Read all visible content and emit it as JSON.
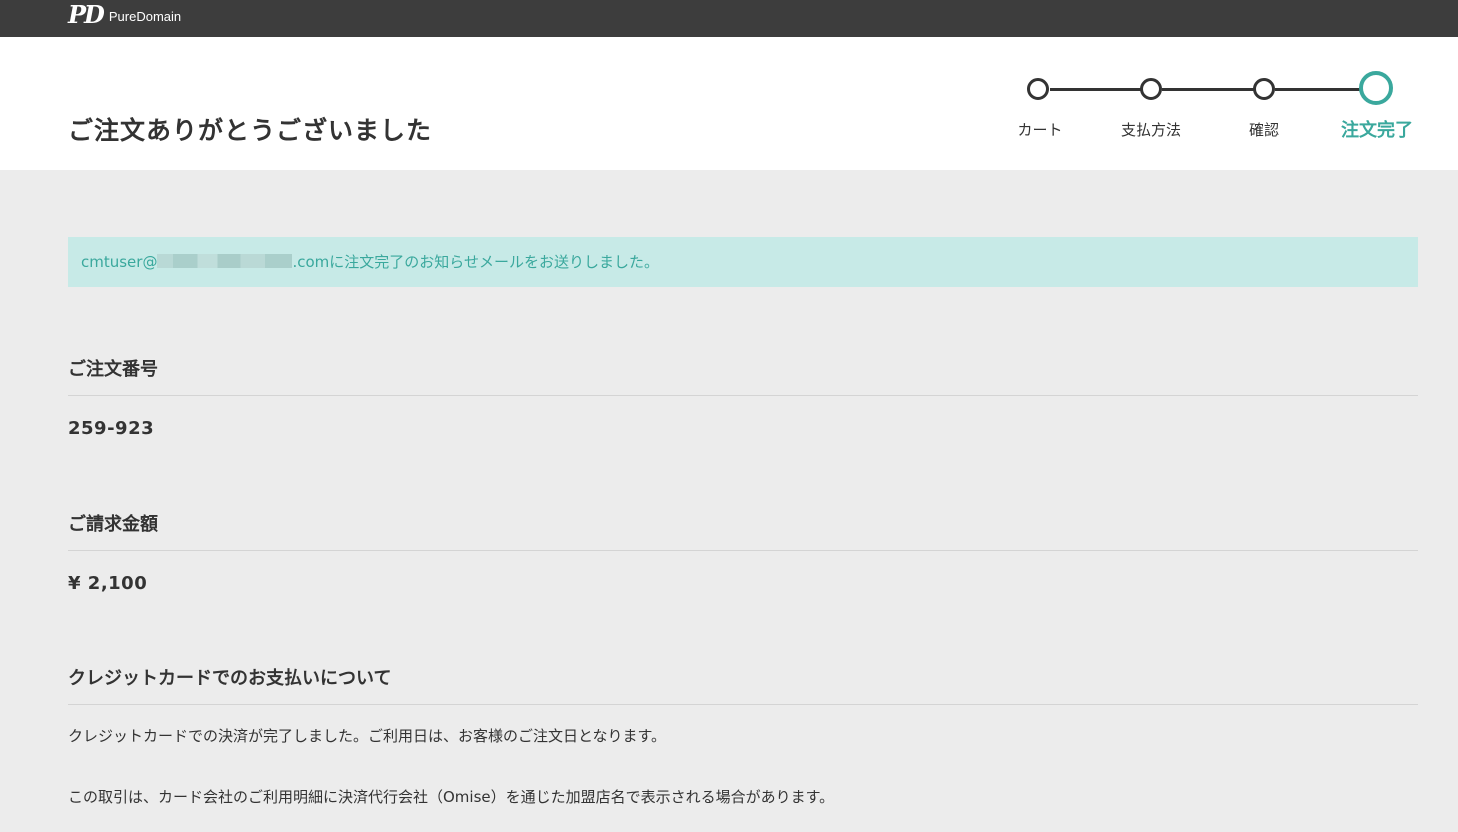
{
  "brand": {
    "mark": "PD",
    "name": "PureDomain"
  },
  "header": {
    "title": "ご注文ありがとうございました"
  },
  "steps": [
    {
      "label": "カート",
      "active": false
    },
    {
      "label": "支払方法",
      "active": false
    },
    {
      "label": "確認",
      "active": false
    },
    {
      "label": "注文完了",
      "active": true
    }
  ],
  "notice": {
    "email_prefix": "cmtuser@",
    "email_suffix": ".com",
    "message": "に注文完了のお知らせメールをお送りしました。"
  },
  "order_number": {
    "label": "ご注文番号",
    "value": "259-923"
  },
  "amount": {
    "label": "ご請求金額",
    "value": "¥ 2,100"
  },
  "payment": {
    "label": "クレジットカードでのお支払いについて",
    "line1": "クレジットカードでの決済が完了しました。ご利用日は、お客様のご注文日となります。",
    "line2": "この取引は、カード会社のご利用明細に決済代行会社（Omise）を通じた加盟店名で表示される場合があります。"
  },
  "colors": {
    "accent": "#3aa89d",
    "topbar": "#3d3d3d",
    "notice_bg": "#c7eae7",
    "page_bg": "#ececec"
  }
}
